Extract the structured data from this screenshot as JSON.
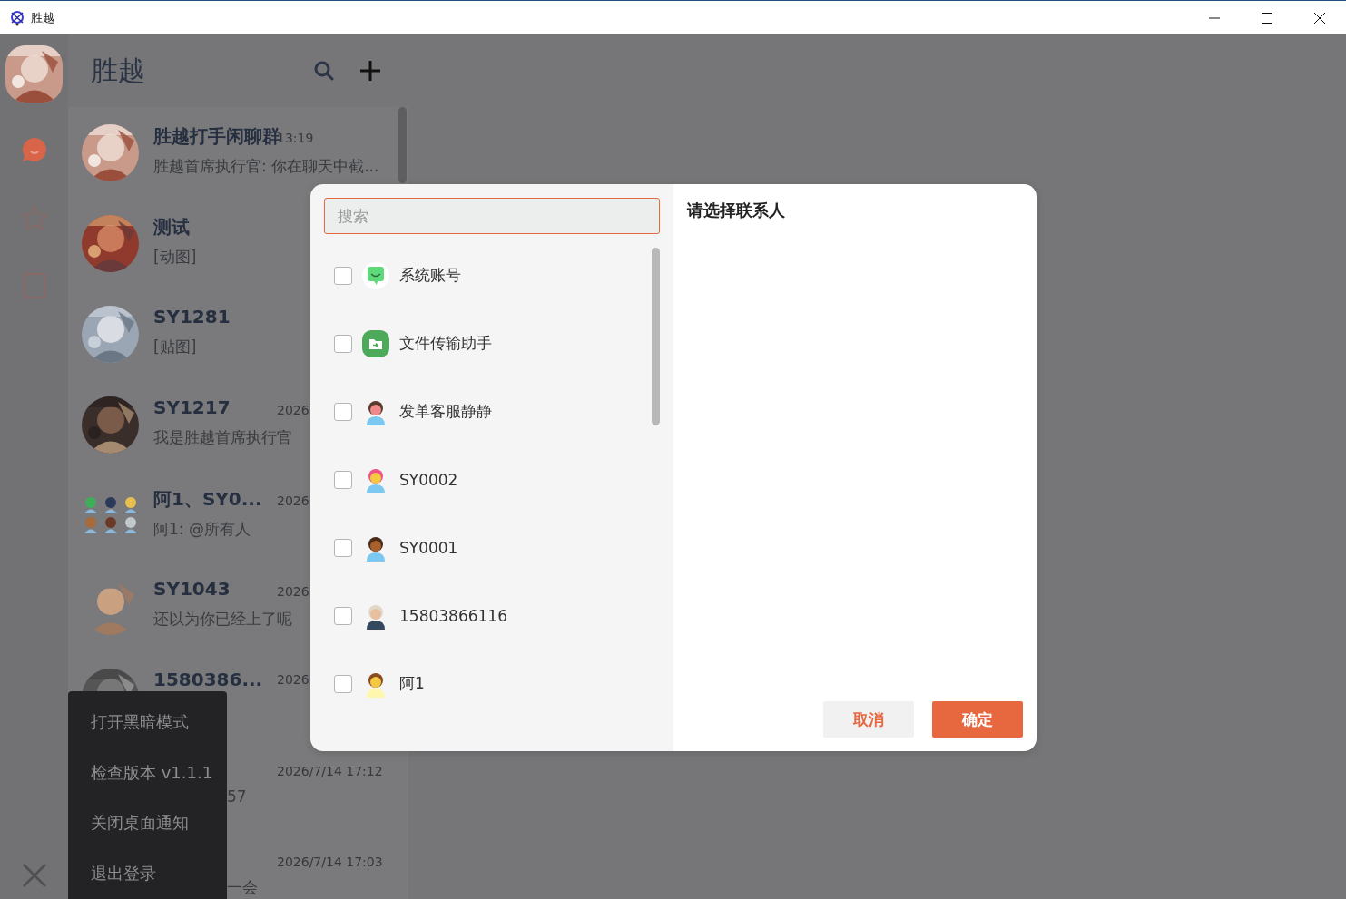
{
  "window": {
    "title": "胜越"
  },
  "header": {
    "title": "胜越"
  },
  "nav_items": [
    {
      "selected": true
    },
    {
      "selected": false
    },
    {
      "selected": false
    }
  ],
  "chats": [
    {
      "kind": "picture",
      "name": "胜越打手闲聊群",
      "time": "13:19",
      "preview": "胜越首席执行官: 你在聊天中截..."
    },
    {
      "kind": "picture",
      "name": "测试",
      "preview": "[动图]"
    },
    {
      "kind": "picture",
      "name": "SY1281",
      "preview": "[贴图]"
    },
    {
      "kind": "picture",
      "name": "SY1217",
      "time": "2026",
      "preview": "我是胜越首席执行官"
    },
    {
      "kind": "group",
      "name": "阿1、SY0...",
      "time": "2026",
      "preview": "阿1: @所有人"
    },
    {
      "kind": "picture",
      "name": "SY1043",
      "time": "2026",
      "preview": "还以为你已经上了呢"
    },
    {
      "kind": "picture",
      "name": "1580386...",
      "time": "2026"
    },
    {
      "kind": "covered",
      "time": "2026/7/14 17:12",
      "preview": "57"
    },
    {
      "kind": "covered",
      "time": "2026/7/14 17:03",
      "preview": "一会"
    }
  ],
  "menu": {
    "items": [
      "打开黑暗模式",
      "检查版本 v1.1.1",
      "关闭桌面通知",
      "退出登录"
    ]
  },
  "dialog": {
    "search": {
      "placeholder": "搜索"
    },
    "contacts": [
      {
        "name": "系统账号",
        "checked": false
      },
      {
        "name": "文件传输助手",
        "checked": false
      },
      {
        "name": "发单客服静静",
        "checked": false
      },
      {
        "name": "SY0002",
        "checked": false
      },
      {
        "name": "SY0001",
        "checked": false
      },
      {
        "name": "15803866116",
        "checked": false
      },
      {
        "name": "阿1",
        "checked": false
      }
    ],
    "title": "请选择联系人",
    "buttons": [
      {
        "label": "取消",
        "kind": "secondary"
      },
      {
        "label": "确定",
        "kind": "primary"
      }
    ]
  }
}
